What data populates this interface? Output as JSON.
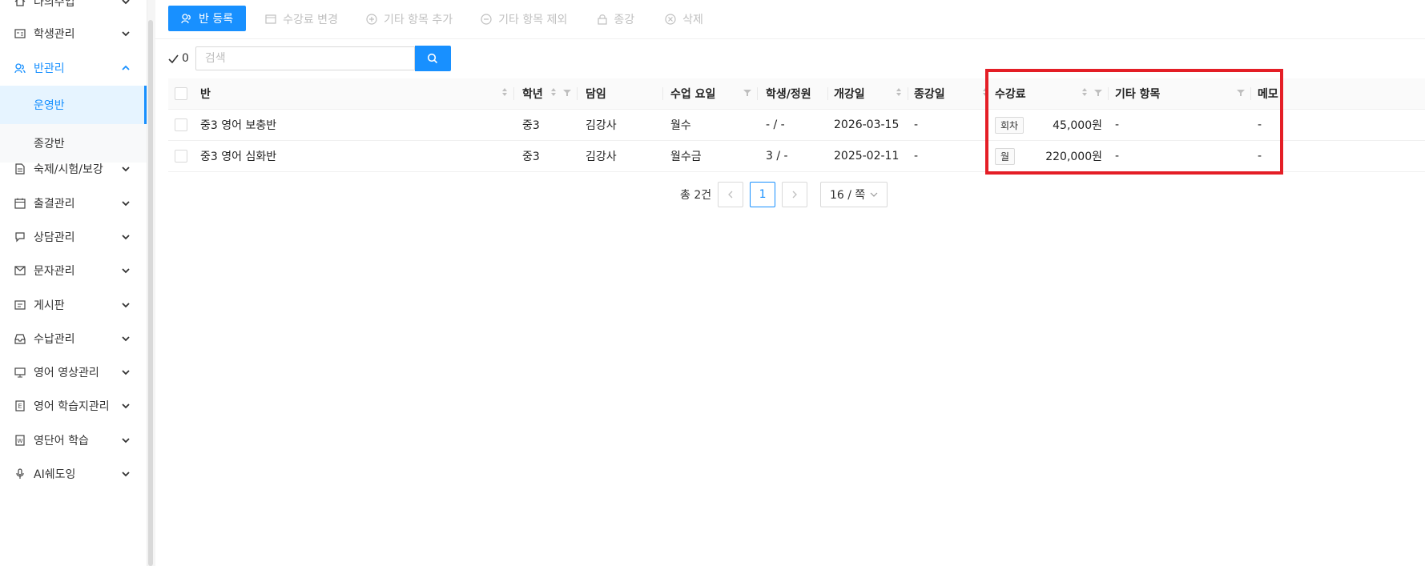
{
  "sidebar": {
    "items": [
      {
        "label": "나의수업",
        "icon": "home-icon"
      },
      {
        "label": "학생관리",
        "icon": "id-card-icon"
      },
      {
        "label": "반관리",
        "icon": "class-icon",
        "active": true
      },
      {
        "label": "숙제/시험/보강",
        "icon": "document-icon"
      },
      {
        "label": "출결관리",
        "icon": "calendar-icon"
      },
      {
        "label": "상담관리",
        "icon": "chat-icon"
      },
      {
        "label": "문자관리",
        "icon": "mail-icon"
      },
      {
        "label": "게시판",
        "icon": "board-icon"
      },
      {
        "label": "수납관리",
        "icon": "inbox-icon"
      },
      {
        "label": "영어 영상관리",
        "icon": "monitor-icon"
      },
      {
        "label": "영어 학습지관리",
        "icon": "worksheet-icon"
      },
      {
        "label": "영단어 학습",
        "icon": "word-icon"
      },
      {
        "label": "AI쉐도잉",
        "icon": "microphone-icon"
      }
    ],
    "sub_items": [
      {
        "label": "운영반",
        "selected": true
      },
      {
        "label": "종강반"
      }
    ]
  },
  "toolbar": {
    "register": "반 등록",
    "change_fee": "수강료 변경",
    "add_other": "기타 항목 추가",
    "remove_other": "기타 항목 제외",
    "close_class": "종강",
    "delete": "삭제"
  },
  "search": {
    "count": "0",
    "placeholder": "검색"
  },
  "table": {
    "headers": {
      "class": "반",
      "grade": "학년",
      "teacher": "담임",
      "days": "수업 요일",
      "students": "학생/정원",
      "start": "개강일",
      "end": "종강일",
      "fee": "수강료",
      "other": "기타 항목",
      "memo": "메모"
    },
    "rows": [
      {
        "class": "중3 영어 보충반",
        "grade": "중3",
        "teacher": "김강사",
        "days": "월수",
        "students": "- / -",
        "start": "2026-03-15",
        "end": "-",
        "fee_type": "회차",
        "fee": "45,000원",
        "other": "-",
        "memo": "-"
      },
      {
        "class": "중3 영어 심화반",
        "grade": "중3",
        "teacher": "김강사",
        "days": "월수금",
        "students": "3 / -",
        "start": "2025-02-11",
        "end": "-",
        "fee_type": "월",
        "fee": "220,000원",
        "other": "-",
        "memo": "-"
      }
    ]
  },
  "pagination": {
    "total": "총 2건",
    "current": "1",
    "page_size": "16 / 쪽"
  },
  "colors": {
    "primary": "#1890ff",
    "highlight": "#e41e26"
  }
}
